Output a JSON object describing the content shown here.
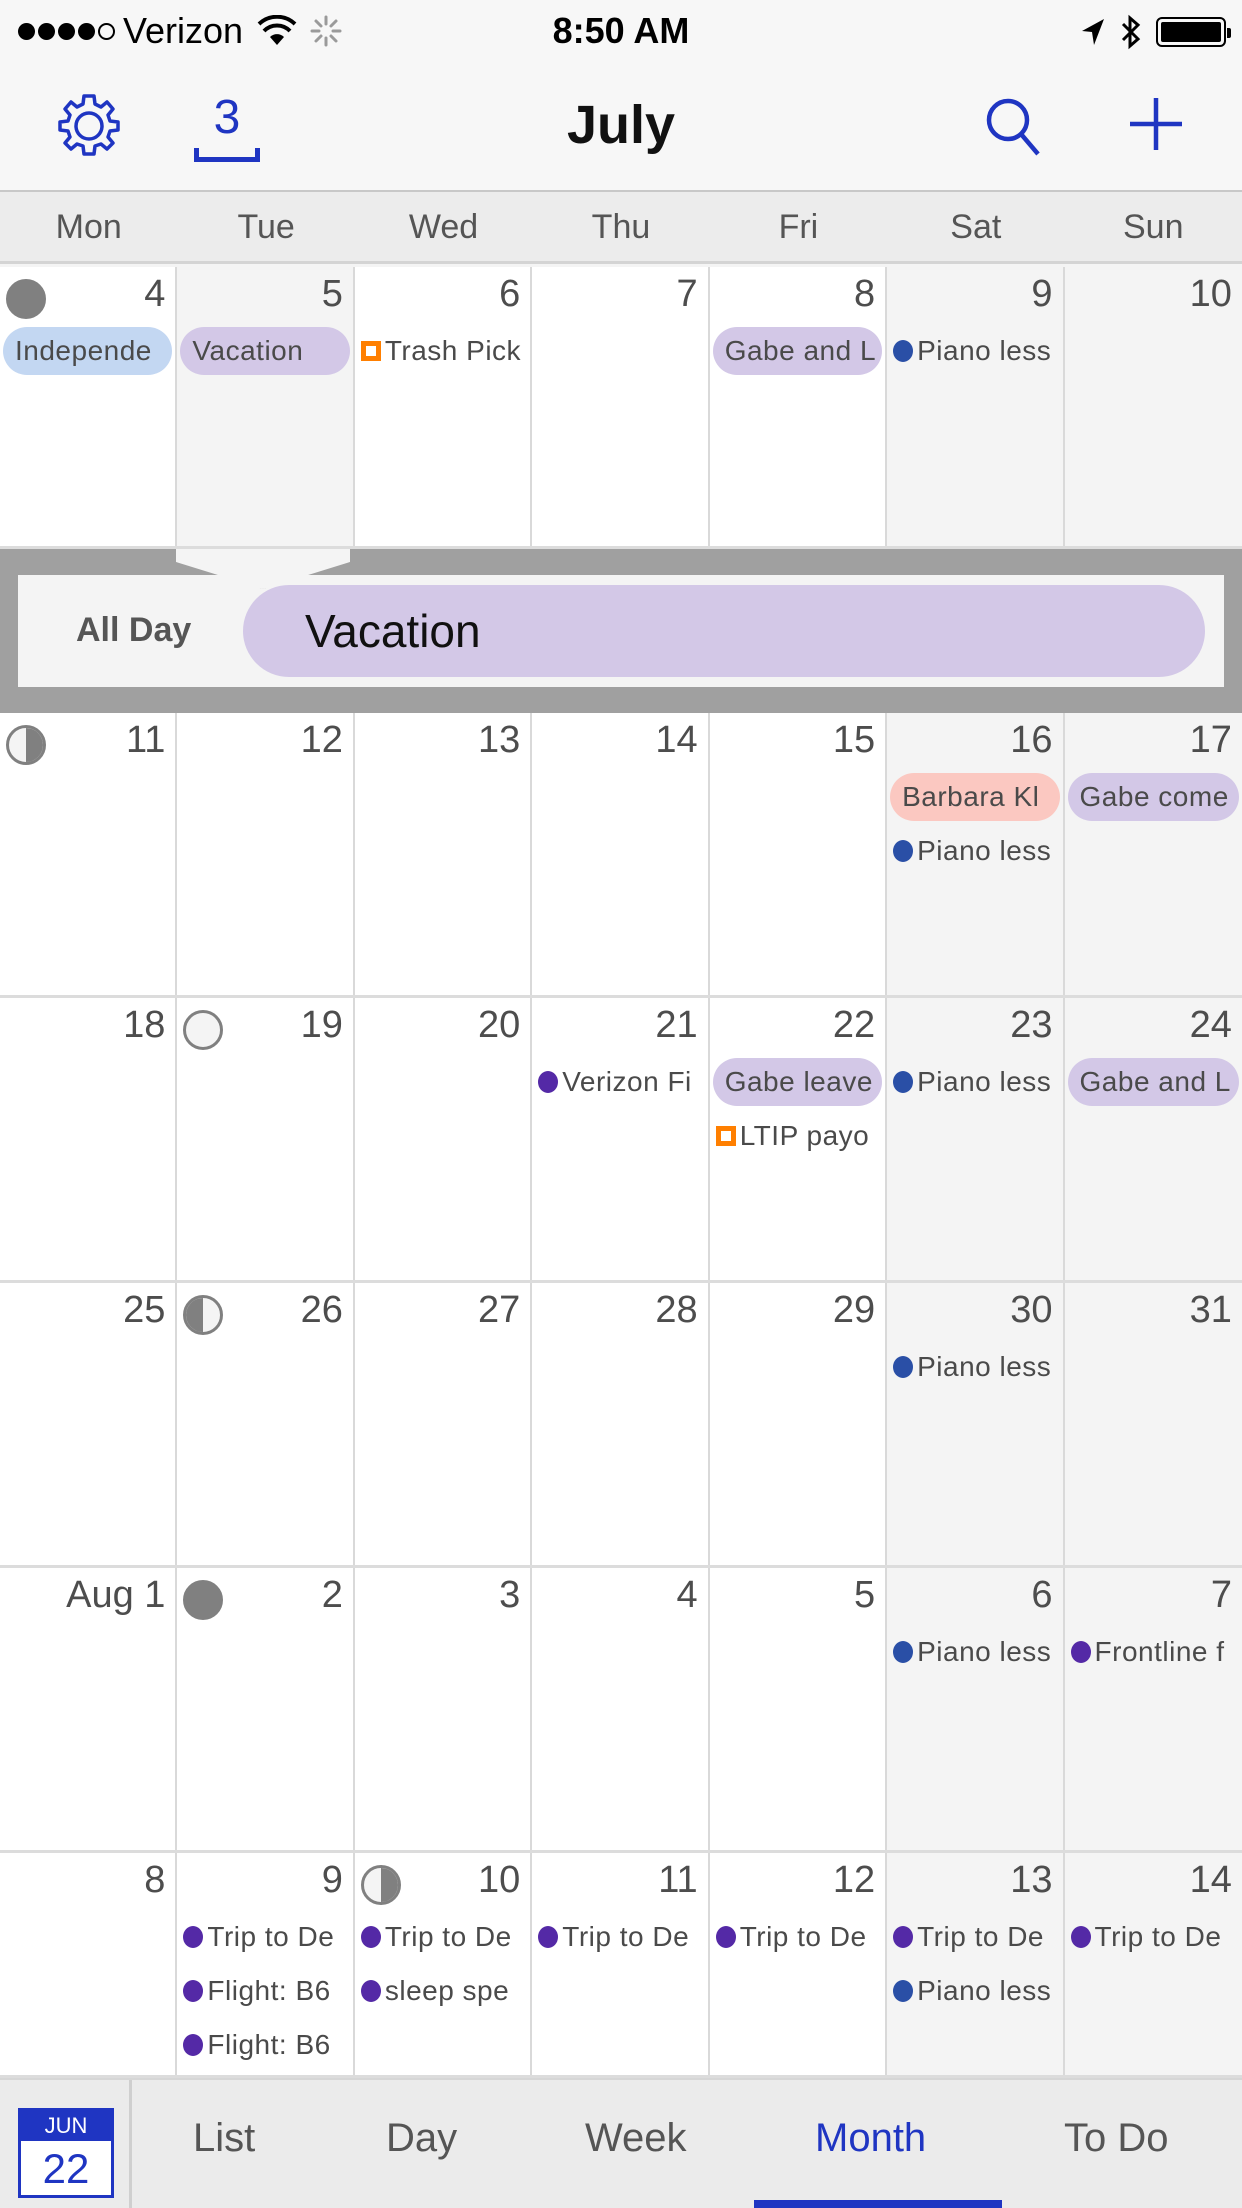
{
  "status_bar": {
    "signal_bars": 4,
    "signal_total": 5,
    "carrier": "Verizon",
    "time": "8:50 AM",
    "battery_level": 1.0
  },
  "nav": {
    "title": "July",
    "today_badge": "3",
    "icons": [
      "gear-icon",
      "calendar-today-icon",
      "search-icon",
      "add-icon"
    ]
  },
  "colors": {
    "accent": "#1f35c2",
    "holiday_blue": "#c3d7f2",
    "lavender": "#d3c8e7",
    "salmon": "#fbc8c1",
    "piano_blue": "#2a4fa6",
    "purple": "#5429a6",
    "orange": "#ff7f00"
  },
  "weekdays": [
    "Mon",
    "Tue",
    "Wed",
    "Thu",
    "Fri",
    "Sat",
    "Sun"
  ],
  "weeks": [
    {
      "days": [
        {
          "label": "4",
          "moon": "full",
          "events": [
            {
              "type": "pill",
              "color": "#c3d7f2",
              "text": "Independe"
            }
          ]
        },
        {
          "label": "5",
          "selected": true,
          "events": [
            {
              "type": "pill",
              "color": "#d3c8e7",
              "text": "Vacation"
            }
          ]
        },
        {
          "label": "6",
          "events": [
            {
              "type": "square",
              "color": "#ff7f00",
              "text": "Trash Pick"
            }
          ]
        },
        {
          "label": "7",
          "events": []
        },
        {
          "label": "8",
          "events": [
            {
              "type": "pill",
              "color": "#d3c8e7",
              "text": "Gabe and L"
            }
          ]
        },
        {
          "label": "9",
          "weekend": true,
          "events": [
            {
              "type": "dot",
              "color": "#2a4fa6",
              "text": "Piano less"
            }
          ]
        },
        {
          "label": "10",
          "weekend": true,
          "events": []
        }
      ]
    },
    {
      "days": [
        {
          "label": "11",
          "moon": "last-quarter",
          "events": []
        },
        {
          "label": "12",
          "events": []
        },
        {
          "label": "13",
          "events": []
        },
        {
          "label": "14",
          "events": []
        },
        {
          "label": "15",
          "events": []
        },
        {
          "label": "16",
          "weekend": true,
          "events": [
            {
              "type": "pill",
              "color": "#fbc8c1",
              "text": "Barbara Kl"
            },
            {
              "type": "dot",
              "color": "#2a4fa6",
              "text": "Piano less"
            }
          ]
        },
        {
          "label": "17",
          "weekend": true,
          "events": [
            {
              "type": "pill",
              "color": "#d3c8e7",
              "text": "Gabe come"
            }
          ]
        }
      ]
    },
    {
      "days": [
        {
          "label": "18",
          "events": []
        },
        {
          "label": "19",
          "moon": "new",
          "events": []
        },
        {
          "label": "20",
          "events": []
        },
        {
          "label": "21",
          "events": [
            {
              "type": "dot",
              "color": "#5429a6",
              "text": "Verizon Fi"
            }
          ]
        },
        {
          "label": "22",
          "events": [
            {
              "type": "pill",
              "color": "#d3c8e7",
              "text": "Gabe leave"
            },
            {
              "type": "square",
              "color": "#ff7f00",
              "text": "LTIP payo"
            }
          ]
        },
        {
          "label": "23",
          "weekend": true,
          "events": [
            {
              "type": "dot",
              "color": "#2a4fa6",
              "text": "Piano less"
            }
          ]
        },
        {
          "label": "24",
          "weekend": true,
          "events": [
            {
              "type": "pill",
              "color": "#d3c8e7",
              "text": "Gabe and L"
            }
          ]
        }
      ]
    },
    {
      "days": [
        {
          "label": "25",
          "events": []
        },
        {
          "label": "26",
          "moon": "first-quarter",
          "events": []
        },
        {
          "label": "27",
          "events": []
        },
        {
          "label": "28",
          "events": []
        },
        {
          "label": "29",
          "events": []
        },
        {
          "label": "30",
          "weekend": true,
          "events": [
            {
              "type": "dot",
              "color": "#2a4fa6",
              "text": "Piano less"
            }
          ]
        },
        {
          "label": "31",
          "weekend": true,
          "events": []
        }
      ]
    },
    {
      "days": [
        {
          "label": "Aug 1",
          "events": []
        },
        {
          "label": "2",
          "moon": "full",
          "events": []
        },
        {
          "label": "3",
          "events": []
        },
        {
          "label": "4",
          "events": []
        },
        {
          "label": "5",
          "events": []
        },
        {
          "label": "6",
          "weekend": true,
          "events": [
            {
              "type": "dot",
              "color": "#2a4fa6",
              "text": "Piano less"
            }
          ]
        },
        {
          "label": "7",
          "weekend": true,
          "events": [
            {
              "type": "dot",
              "color": "#5429a6",
              "text": "Frontline f"
            }
          ]
        }
      ]
    },
    {
      "days": [
        {
          "label": "8",
          "events": []
        },
        {
          "label": "9",
          "events": [
            {
              "type": "dot",
              "color": "#5429a6",
              "text": "Trip to De"
            },
            {
              "type": "dot",
              "color": "#5429a6",
              "text": "Flight: B6"
            },
            {
              "type": "dot",
              "color": "#5429a6",
              "text": "Flight: B6"
            }
          ]
        },
        {
          "label": "10",
          "moon": "last-quarter",
          "events": [
            {
              "type": "dot",
              "color": "#5429a6",
              "text": "Trip to De"
            },
            {
              "type": "dot",
              "color": "#5429a6",
              "text": "sleep spe"
            }
          ]
        },
        {
          "label": "11",
          "events": [
            {
              "type": "dot",
              "color": "#5429a6",
              "text": "Trip to De"
            }
          ]
        },
        {
          "label": "12",
          "events": [
            {
              "type": "dot",
              "color": "#5429a6",
              "text": "Trip to De"
            }
          ]
        },
        {
          "label": "13",
          "weekend": true,
          "events": [
            {
              "type": "dot",
              "color": "#5429a6",
              "text": "Trip to De"
            },
            {
              "type": "dot",
              "color": "#2a4fa6",
              "text": "Piano less"
            }
          ]
        },
        {
          "label": "14",
          "weekend": true,
          "events": [
            {
              "type": "dot",
              "color": "#5429a6",
              "text": "Trip to De"
            }
          ]
        }
      ]
    }
  ],
  "popover": {
    "all_day_label": "All Day",
    "event_title": "Vacation"
  },
  "tab_bar": {
    "today_month": "JUN",
    "today_day": "22",
    "tabs": [
      {
        "label": "List",
        "active": false
      },
      {
        "label": "Day",
        "active": false
      },
      {
        "label": "Week",
        "active": false
      },
      {
        "label": "Month",
        "active": true
      },
      {
        "label": "To Do",
        "active": false
      }
    ]
  }
}
